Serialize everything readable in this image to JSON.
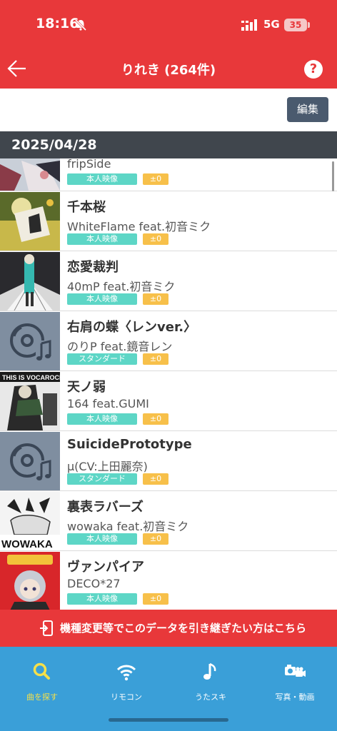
{
  "status_bar": {
    "time": "18:16",
    "network": "5G",
    "battery": "35"
  },
  "header": {
    "title": "りれき (264件)",
    "help": "?"
  },
  "toolbar": {
    "edit_label": "編集"
  },
  "date_group": "2025/04/28",
  "songs": [
    {
      "title": "",
      "artist": "fripSide",
      "tag": "本人映像",
      "score": "±0"
    },
    {
      "title": "千本桜",
      "artist": "WhiteFlame feat.初音ミク",
      "tag": "本人映像",
      "score": "±0"
    },
    {
      "title": "恋愛裁判",
      "artist": "40mP feat.初音ミク",
      "tag": "本人映像",
      "score": "±0"
    },
    {
      "title": "右肩の蝶〈レンver.〉",
      "artist": "のりP feat.鏡音レン",
      "tag": "スタンダード",
      "score": "±0"
    },
    {
      "title": "天ノ弱",
      "artist": "164 feat.GUMI",
      "tag": "本人映像",
      "score": "±0"
    },
    {
      "title": "SuicidePrototype",
      "artist": "μ(CV:上田麗奈)",
      "tag": "スタンダード",
      "score": "±0"
    },
    {
      "title": "裏表ラバーズ",
      "artist": "wowaka feat.初音ミク",
      "tag": "本人映像",
      "score": "±0"
    },
    {
      "title": "ヴァンパイア",
      "artist": "DECO*27",
      "tag": "本人映像",
      "score": "±0"
    }
  ],
  "thumb_texts": {
    "vocarock": "THIS IS VOCAROCK",
    "wowaka": "WOWAKA"
  },
  "banner": {
    "text": "機種変更等でこのデータを引き継ぎたい方はこちら"
  },
  "tabs": [
    {
      "label": "曲を探す",
      "icon": "search-icon",
      "active": true
    },
    {
      "label": "リモコン",
      "icon": "wifi-icon",
      "active": false
    },
    {
      "label": "うたスキ",
      "icon": "music-note-icon",
      "active": false
    },
    {
      "label": "写真・動画",
      "icon": "camera-icon",
      "active": false
    }
  ],
  "colors": {
    "header": "#e8383a",
    "tabbar": "#3a9fd8",
    "active_tab": "#f5e04a",
    "tag_teal": "#5dd6c6",
    "score_yellow": "#f7c04a",
    "date_bar": "#40464d",
    "edit_button": "#4a5a6e"
  }
}
